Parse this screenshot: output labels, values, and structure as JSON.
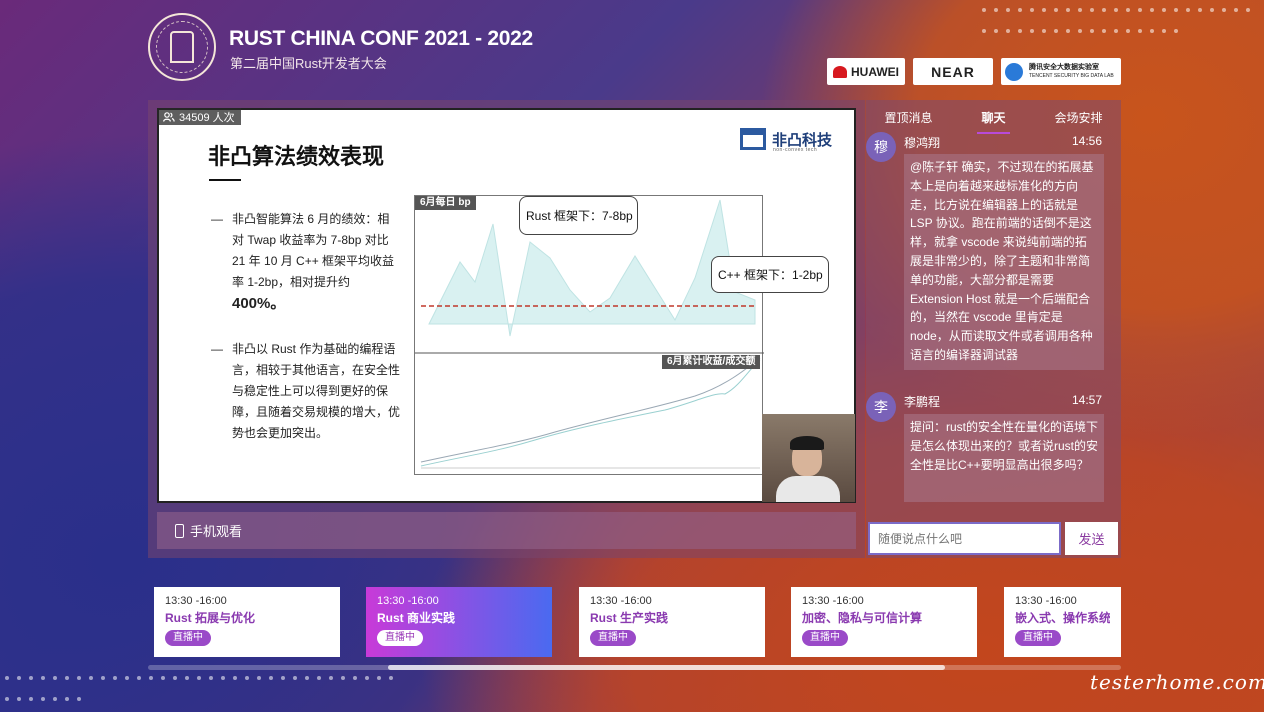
{
  "header": {
    "title": "RUST CHINA CONF 2021 - 2022",
    "subtitle": "第二届中国Rust开发者大会"
  },
  "sponsors": {
    "huawei": "HUAWEI",
    "near": "NEAR",
    "tencent_line1": "腾讯安全大数据实验室",
    "tencent_line2": "TENCENT SECURITY BIG DATA LAB"
  },
  "player": {
    "viewers": "34509 人次",
    "mobile_watch": "手机观看"
  },
  "slide": {
    "title": "非凸算法绩效表现",
    "company": "非凸科技",
    "company_sub": "non-convex tech",
    "bullet1_dash": "—",
    "bullet1_text": "非凸智能算法 6 月的绩效：相对 Twap 收益率为 7-8bp 对比 21 年 10 月 C++ 框架平均收益率 1-2bp，相对提升约",
    "bullet1_big": "400%。",
    "bullet2_dash": "—",
    "bullet2_text": "非凸以 Rust 作为基础的编程语言，相较于其他语言，在安全性与稳定性上可以得到更好的保障，且随着交易规模的增大，优势也会更加突出。",
    "chart1_tag": "6月每日 bp",
    "chart2_tag": "6月累计收益/成交额",
    "callout1": "Rust 框架下：7-8bp",
    "callout2": "C++ 框架下：1-2bp"
  },
  "chat": {
    "tabs": [
      "置顶消息",
      "聊天",
      "会场安排"
    ],
    "messages": [
      {
        "avatar": "穆",
        "name": "穆鸿翔",
        "time": "14:56",
        "text": "@陈子轩 确实，不过现在的拓展基本上是向着越来越标准化的方向走，比方说在编辑器上的话就是 LSP 协议。跑在前端的话倒不是这样，就拿 vscode 来说纯前端的拓展是非常少的，除了主题和非常简单的功能，大部分都是需要 Extension Host 就是一个后端配合的，当然在 vscode 里肯定是 node，从而读取文件或者调用各种语言的编译器调试器"
      },
      {
        "avatar": "李",
        "name": "李鹏程",
        "time": "14:57",
        "text": "提问：rust的安全性在量化的语境下是怎么体现出来的？或者说rust的安全性是比C++要明显高出很多吗？"
      }
    ],
    "input_placeholder": "随便说点什么吧",
    "send_label": "发送"
  },
  "sessions": [
    {
      "time": "13:30 -16:00",
      "name": "Rust 拓展与优化",
      "badge": "直播中"
    },
    {
      "time": "13:30 -16:00",
      "name": "Rust 商业实践",
      "badge": "直播中"
    },
    {
      "time": "13:30 -16:00",
      "name": "Rust 生产实践",
      "badge": "直播中"
    },
    {
      "time": "13:30 -16:00",
      "name": "加密、隐私与可信计算",
      "badge": "直播中"
    },
    {
      "time": "13:30 -16:00",
      "name": "嵌入式、操作系统与",
      "badge": "直播中"
    }
  ],
  "watermark": "testerhome.com",
  "colors": {
    "accent_purple": "#9a4ac8",
    "active_gradient_start": "#c83ad8",
    "active_gradient_end": "#4a6af0",
    "chart_fill": "#d9f1f1",
    "chart_line": "#bfe3e3",
    "avg_line": "#c0392b"
  }
}
